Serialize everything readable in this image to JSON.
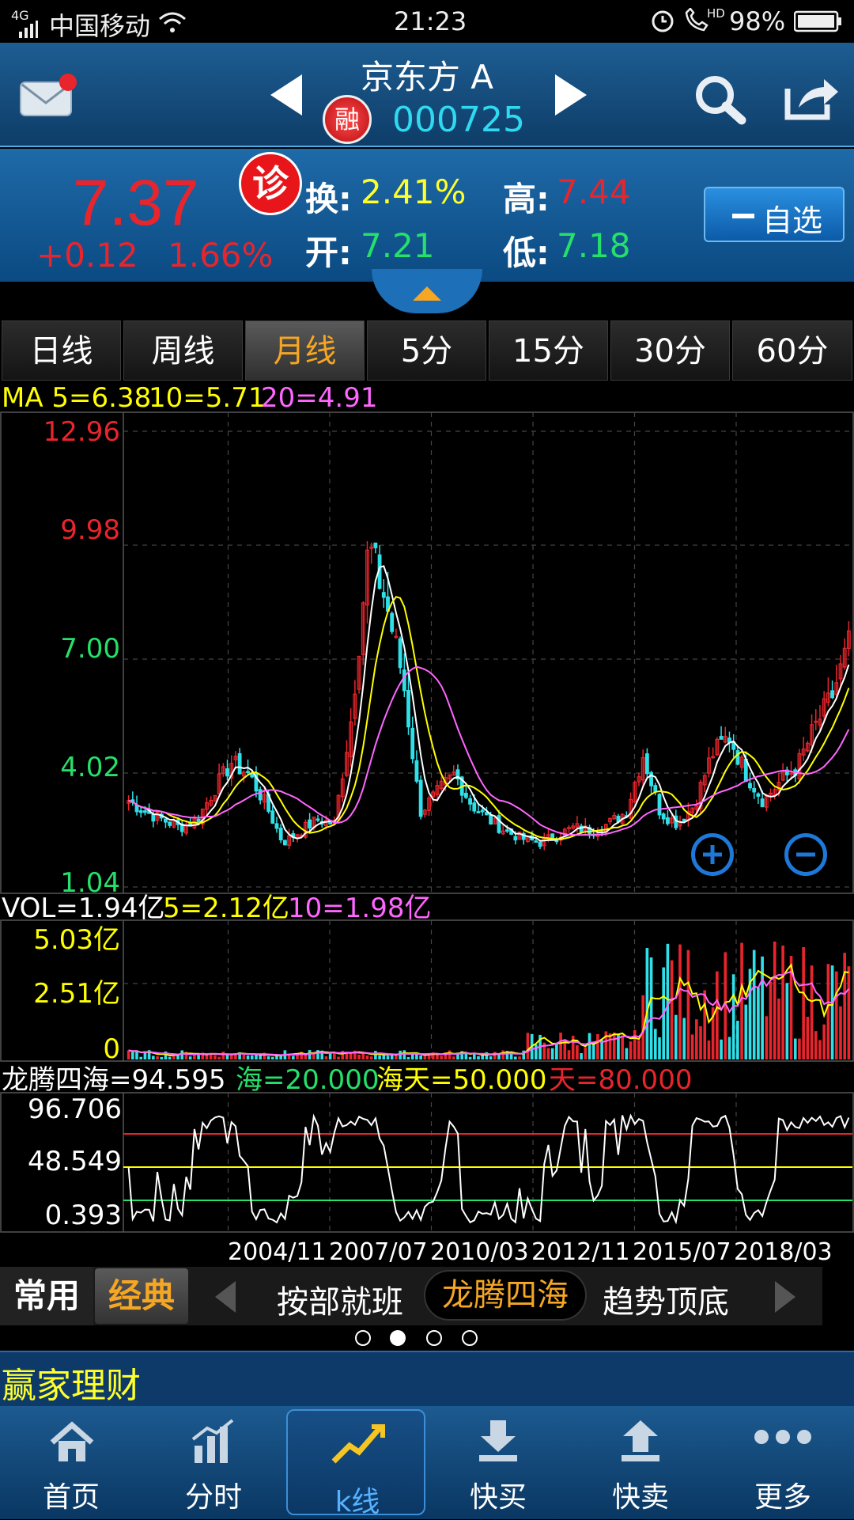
{
  "status_bar": {
    "network": "4G",
    "carrier": "中国移动",
    "time": "21:23",
    "hd": "HD",
    "battery": "98%"
  },
  "header": {
    "stock_name": "京东方 A",
    "margin_badge": "融",
    "stock_code": "000725"
  },
  "quote": {
    "price": "7.37",
    "change": "+0.12",
    "change_pct": "1.66%",
    "diag_badge": "诊",
    "turnover_label": "换:",
    "turnover": "2.41%",
    "high_label": "高:",
    "high": "7.44",
    "open_label": "开:",
    "open": "7.21",
    "low_label": "低:",
    "low": "7.18",
    "watchlist_button": "自选"
  },
  "tabs": [
    "日线",
    "周线",
    "月线",
    "5分",
    "15分",
    "30分",
    "60分"
  ],
  "active_tab": "月线",
  "ma_legend": {
    "ma": "MA 5=6.38",
    "ma10": "10=5.71",
    "ma20": "20=4.91"
  },
  "price_axis": [
    "12.96",
    "9.98",
    "7.00",
    "4.02",
    "1.04"
  ],
  "vol_legend": {
    "vol": "VOL=1.94亿",
    "vol5": "5=2.12亿",
    "vol10": "10=1.98亿"
  },
  "vol_axis": [
    "5.03亿",
    "2.51亿",
    "0"
  ],
  "ind_legend": {
    "name": "龙腾四海=94.595",
    "hai": "海=20.000",
    "haitian": "海天=50.000",
    "tian": "天=80.000"
  },
  "ind_axis": [
    "96.706",
    "48.549",
    "0.393"
  ],
  "dates": [
    "2004/11",
    "2007/07",
    "2010/03",
    "2012/11",
    "2015/07",
    "2018/03"
  ],
  "indicator_bar": {
    "common": "常用",
    "classic": "经典",
    "items": [
      "按部就班",
      "龙腾四海",
      "趋势顶底"
    ],
    "active": "龙腾四海"
  },
  "banner": "赢家理财",
  "nav": [
    "首页",
    "分时",
    "k线",
    "快买",
    "快卖",
    "更多"
  ],
  "nav_active": "k线",
  "colors": {
    "up": "#e8252c",
    "down": "#2fe0e8",
    "ma5": "#ffffff",
    "ma10": "#ffff00",
    "ma20": "#ff66ff",
    "accent": "#f5a623"
  },
  "chart_data": {
    "type": "candlestick",
    "price_range": [
      1.04,
      12.96
    ],
    "x_ticks": [
      "2004/11",
      "2007/07",
      "2010/03",
      "2012/11",
      "2015/07",
      "2018/03"
    ],
    "close_approx": [
      3.3,
      3.0,
      2.8,
      2.6,
      2.8,
      3.6,
      4.3,
      4.0,
      3.2,
      2.2,
      2.5,
      2.8,
      2.7,
      5.5,
      10.0,
      8.5,
      6.5,
      3.0,
      3.5,
      4.0,
      3.2,
      2.8,
      2.5,
      2.3,
      2.2,
      2.4,
      2.6,
      2.5,
      2.7,
      3.0,
      4.5,
      3.0,
      2.7,
      3.2,
      4.5,
      5.0,
      4.0,
      3.3,
      3.8,
      4.2,
      5.2,
      6.0,
      7.37
    ],
    "hot_hai": 20.0,
    "hot_haitian": 50.0,
    "hot_tian": 80.0
  }
}
